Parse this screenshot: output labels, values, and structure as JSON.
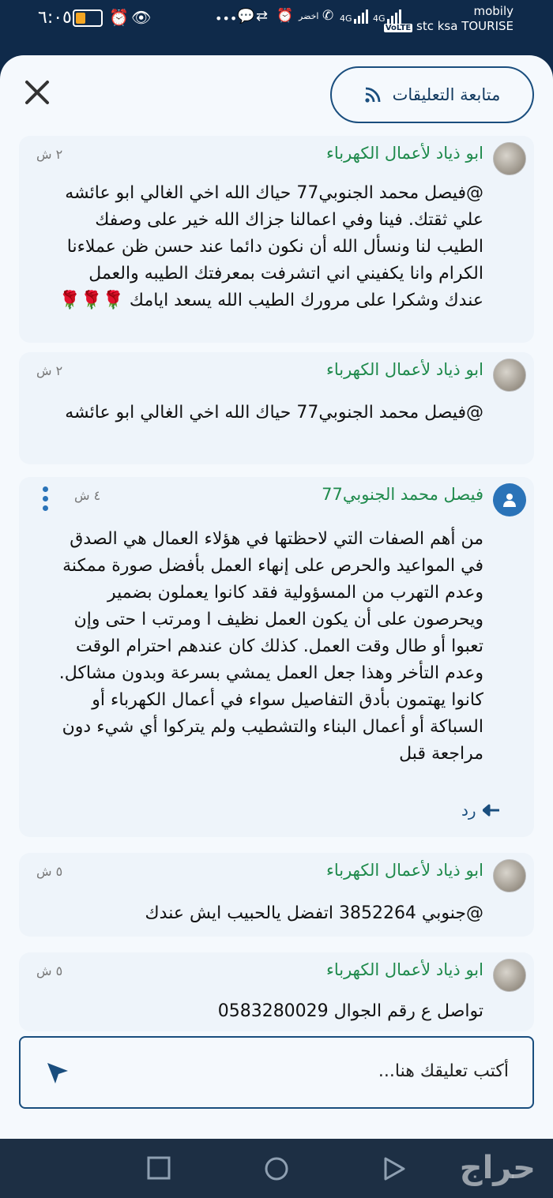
{
  "status_bar": {
    "time": "٦:٠٥",
    "carrier_line1": "mobily",
    "carrier_line2": "stc ksa TOURISE",
    "volte": "VoLTE",
    "net1": "4G",
    "net2": "4G",
    "operator_tag": "اخضر"
  },
  "header": {
    "follow_label": "متابعة التعليقات"
  },
  "comments": [
    {
      "author": "ابو ذياد لأعمال الكهرباء",
      "time": "٢ ش",
      "text": "@فيصل محمد الجنوبي77   حياك الله اخي الغالي ابو عائشه علي ثقتك. فينا وفي اعمالنا جزاك الله خير على وصفك الطيب لنا ونسأل الله أن نكون دائما عند حسن ظن عملاءنا الكرام وانا يكفيني اني اتشرفت بمعرفتك الطيبه والعمل عندك وشكرا على مرورك الطيب الله يسعد ايامك 🌹🌹🌹"
    },
    {
      "author": "ابو ذياد لأعمال الكهرباء",
      "time": "٢ ش",
      "text": "@فيصل محمد الجنوبي77   حياك الله اخي الغالي ابو عائشه"
    },
    {
      "author": "فيصل محمد الجنوبي77",
      "time": "٤ ش",
      "text": "من أهم الصفات التي لاحظتها في هؤلاء العمال هي الصدق في المواعيد  والحرص على إنهاء العمل بأفضل صورة ممكنة  وعدم التهرب من المسؤولية  فقد كانوا يعملون بضمير  ويحرصون على أن يكون العمل نظيف ا ومرتب ا حتى وإن تعبوا أو طال وقت العمل.  كذلك كان عندهم احترام الوقت وعدم التأخر  وهذا جعل العمل يمشي بسرعة وبدون مشاكل. كانوا يهتمون بأدق التفاصيل  سواء في أعمال الكهرباء أو السباكة أو أعمال البناء والتشطيب  ولم يتركوا أي شيء دون مراجعة قبل",
      "reply_label": "رد"
    },
    {
      "author": "ابو ذياد لأعمال الكهرباء",
      "time": "٥ ش",
      "text": "@جنوبي 3852264   اتفضل يالحبيب ايش عندك"
    },
    {
      "author": "ابو ذياد لأعمال الكهرباء",
      "time": "٥ ش",
      "text": "تواصل ع رقم الجوال 0583280029"
    }
  ],
  "composer": {
    "placeholder": "أكتب تعليقك هنا..."
  },
  "watermark": "حراج",
  "colors": {
    "primary": "#1a4e7e",
    "author_green": "#1f8a4c",
    "card_bg": "#eef4fa",
    "status_bg": "#0f2a4a"
  }
}
